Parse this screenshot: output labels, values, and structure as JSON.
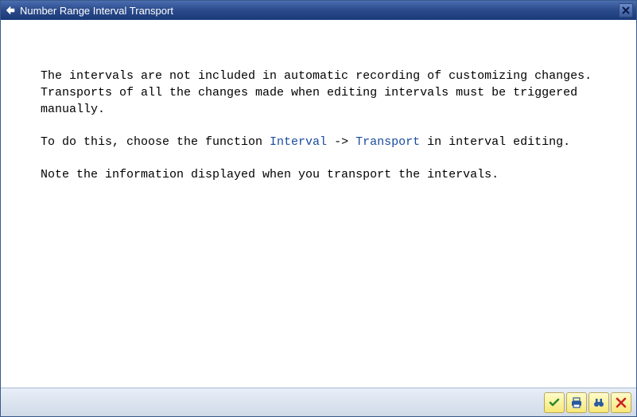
{
  "window": {
    "title": "Number Range Interval Transport"
  },
  "content": {
    "para1": "The intervals are not included in automatic recording of customizing changes. Transports of all the changes made when editing intervals must be triggered manually.",
    "para2_prefix": "To do this, choose the function ",
    "para2_menu1": "Interval",
    "para2_arrow": " -> ",
    "para2_menu2": "Transport",
    "para2_suffix": " in interval editing.",
    "para3": "Note the information displayed when you transport the intervals."
  },
  "icons": {
    "title_icon": "share-arrow",
    "close": "x",
    "confirm": "checkmark",
    "print": "printer",
    "search": "binoculars",
    "cancel": "x-red"
  }
}
